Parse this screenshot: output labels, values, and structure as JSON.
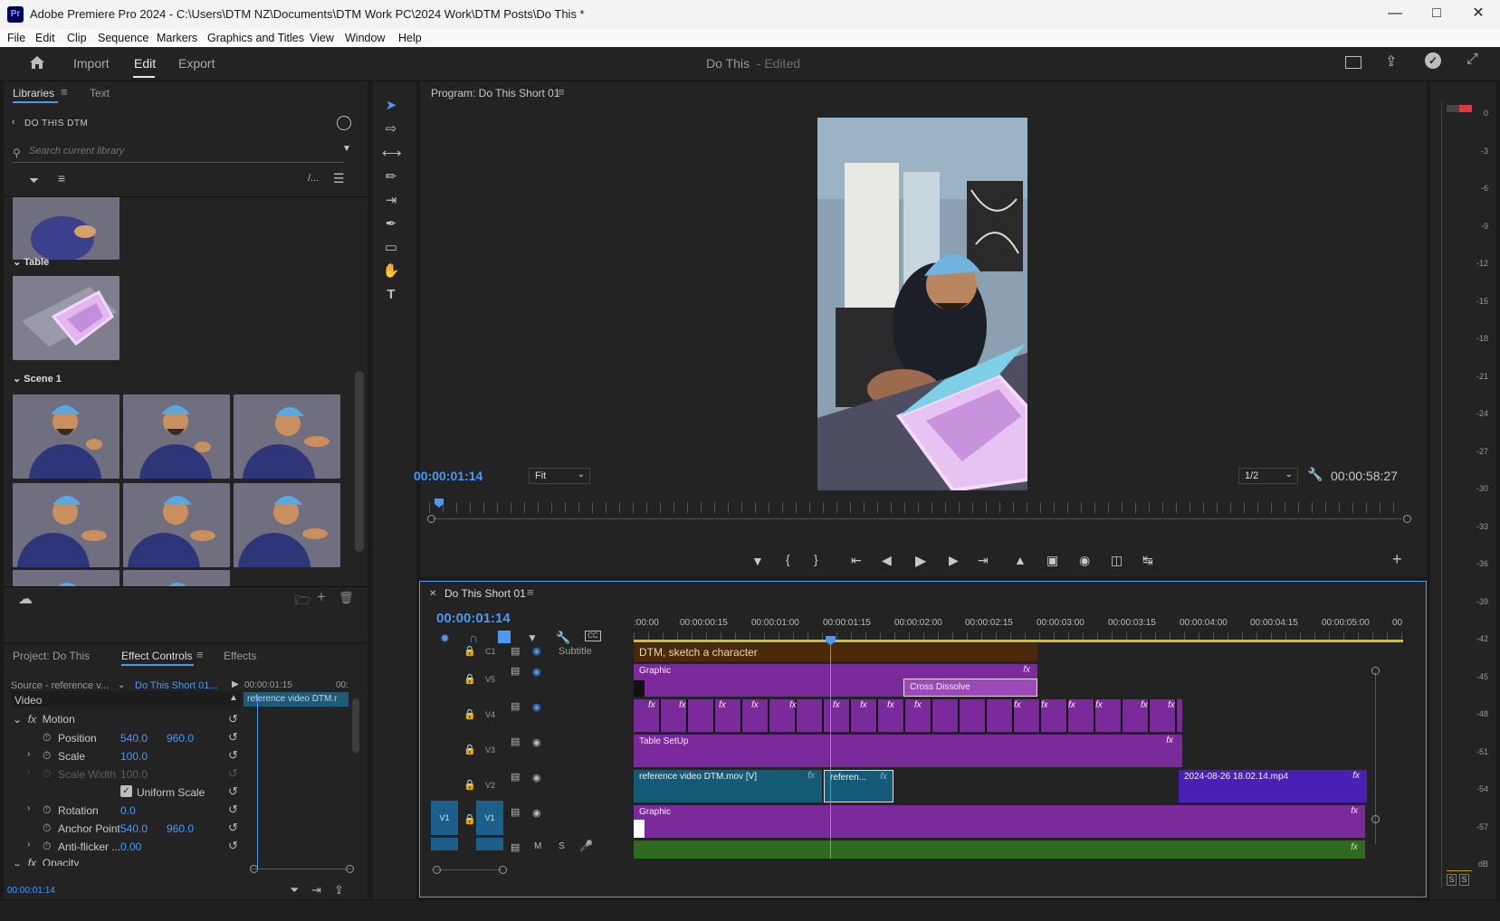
{
  "window": {
    "title": "Adobe Premiere Pro 2024 - C:\\Users\\DTM NZ\\Documents\\DTM Work PC\\2024 Work\\DTM Posts\\Do This *",
    "logo": "Pr"
  },
  "menu": [
    "File",
    "Edit",
    "Clip",
    "Sequence",
    "Markers",
    "Graphics and Titles",
    "View",
    "Window",
    "Help"
  ],
  "appbar": {
    "import": "Import",
    "edit": "Edit",
    "export": "Export",
    "project": "Do This",
    "status": "- Edited"
  },
  "libraries": {
    "tab_libraries": "Libraries",
    "tab_text": "Text",
    "breadcrumb": "DO THIS DTM",
    "search_placeholder": "Search current library",
    "group_table": "Table",
    "group_scene": "Scene 1",
    "sort_label": "/..."
  },
  "program": {
    "title": "Program: Do This Short 01",
    "timecode": "00:00:01:14",
    "fit": "Fit",
    "resolution": "1/2",
    "duration": "00:00:58:27"
  },
  "timeline": {
    "tab": "Do This Short 01",
    "timecode": "00:00:01:14",
    "ruler": [
      ":00:00",
      "00:00:00:15",
      "00:00:01:00",
      "00:00:01:15",
      "00:00:02:00",
      "00:00:02:15",
      "00:00:03:00",
      "00:00:03:15",
      "00:00:04:00",
      "00:00:04:15",
      "00:00:05:00",
      "00"
    ],
    "tracks": {
      "c1": "C1",
      "subtitle": "Subtitle",
      "v5": "V5",
      "v4": "V4",
      "v3": "V3",
      "v2": "V2",
      "v1": "V1",
      "v1src": "V1",
      "m": "M",
      "s": "S"
    },
    "clips": {
      "caption": "DTM, sketch a character",
      "graphic_v5": "Graphic",
      "cross_dissolve": "Cross Dissolve",
      "table_setup": "Table SetUp",
      "ref_video": "reference video DTM.mov [V]",
      "ref_short": "referen...",
      "date_clip": "2024-08-26 18.02.14.mp4",
      "graphic_v1": "Graphic",
      "fx": "fx"
    }
  },
  "effect_controls": {
    "tab_project": "Project: Do This",
    "tab_ec": "Effect Controls",
    "tab_effects": "Effects",
    "source": "Source - reference v...",
    "sequence": "Do This Short 01...",
    "tc_mini": "00:00:01:15",
    "tc_mini2": "00:",
    "clip_name": "reference video DTM.r",
    "section_video": "Video",
    "motion": "Motion",
    "position": "Position",
    "pos_x": "540.0",
    "pos_y": "960.0",
    "scale": "Scale",
    "scale_v": "100.0",
    "scale_width": "Scale Width",
    "scale_width_v": "100.0",
    "uniform": "Uniform Scale",
    "rotation": "Rotation",
    "rotation_v": "0.0",
    "anchor": "Anchor Point",
    "anchor_x": "540.0",
    "anchor_y": "960.0",
    "antiflicker": "Anti-flicker ...",
    "antiflicker_v": "0.00",
    "opacity": "Opacity",
    "bottom_tc": "00:00:01:14"
  },
  "meter": {
    "ticks": [
      "0",
      "-3",
      "-6",
      "-9",
      "-12",
      "-15",
      "-18",
      "-21",
      "-24",
      "-27",
      "-30",
      "-33",
      "-36",
      "-39",
      "-42",
      "-45",
      "-48",
      "-51",
      "-54",
      "-57",
      "dB"
    ],
    "solo": "S"
  },
  "colors": {
    "accent": "#4a9af5",
    "purple": "#7a2a9a",
    "teal": "#155a76",
    "caption": "#4b2a0c"
  }
}
